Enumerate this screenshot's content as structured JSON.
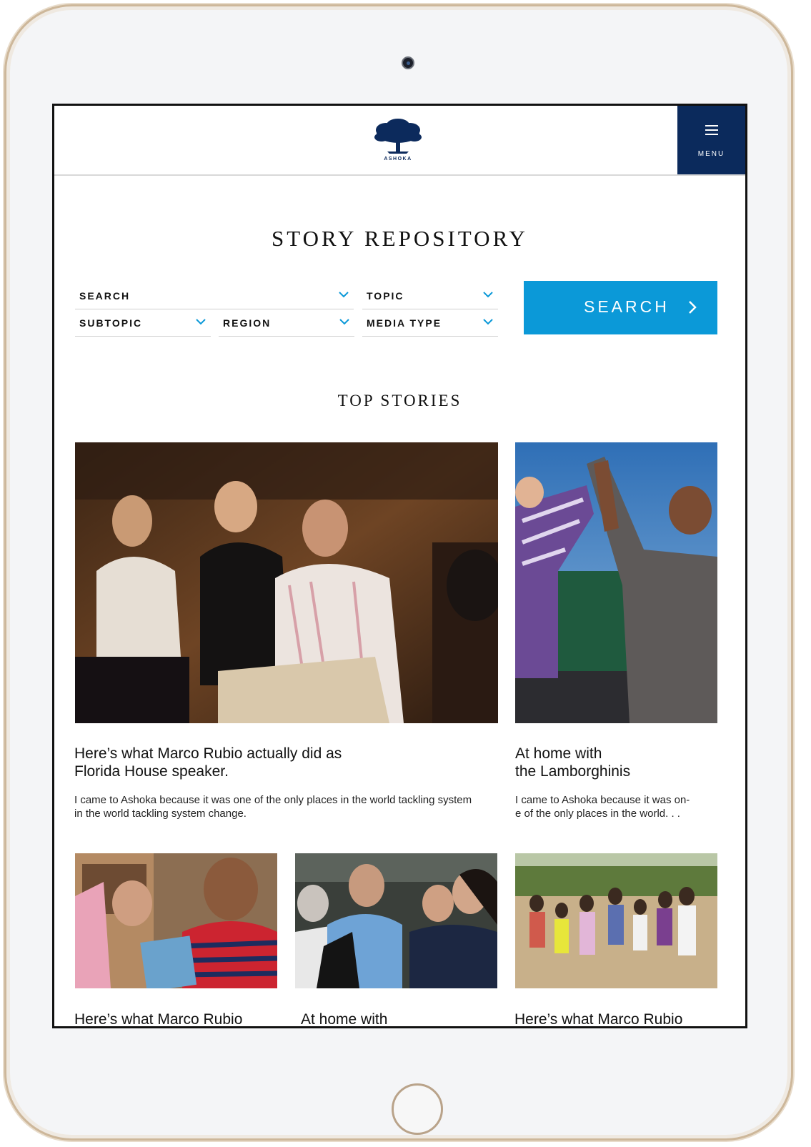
{
  "brand": {
    "logo_text": "ASHOKA",
    "navy": "#0b2a5c",
    "accent": "#0b99d8"
  },
  "header": {
    "menu_label": "MENU",
    "menu_icon": "hamburger-icon"
  },
  "page": {
    "title": "STORY REPOSITORY"
  },
  "filters": {
    "search": "SEARCH",
    "topic": "TOPIC",
    "subtopic": "SUBTOPIC",
    "region": "REGION",
    "media_type": "MEDIA TYPE",
    "chevron_icon": "chevron-down-icon"
  },
  "search_button": {
    "label": "SEARCH",
    "icon": "chevron-right-icon"
  },
  "top_stories": {
    "title": "TOP STORIES",
    "featured": [
      {
        "title_line1": "Here’s what Marco Rubio actually did as",
        "title_line2": "Florida House speaker.",
        "excerpt_line1": "I came to Ashoka because it was one of the only places in the world tackling system",
        "excerpt_line2": "in the world tackling system change."
      },
      {
        "title_line1": "At home with",
        "title_line2": "the Lamborghinis",
        "excerpt_line1": "I came to Ashoka because it was on-",
        "excerpt_line2": "e of the only places in the world. . ."
      }
    ],
    "row2": [
      {
        "title": "Here’s what Marco Rubio"
      },
      {
        "title": "At home with"
      },
      {
        "title": "Here’s what Marco Rubio"
      }
    ]
  }
}
